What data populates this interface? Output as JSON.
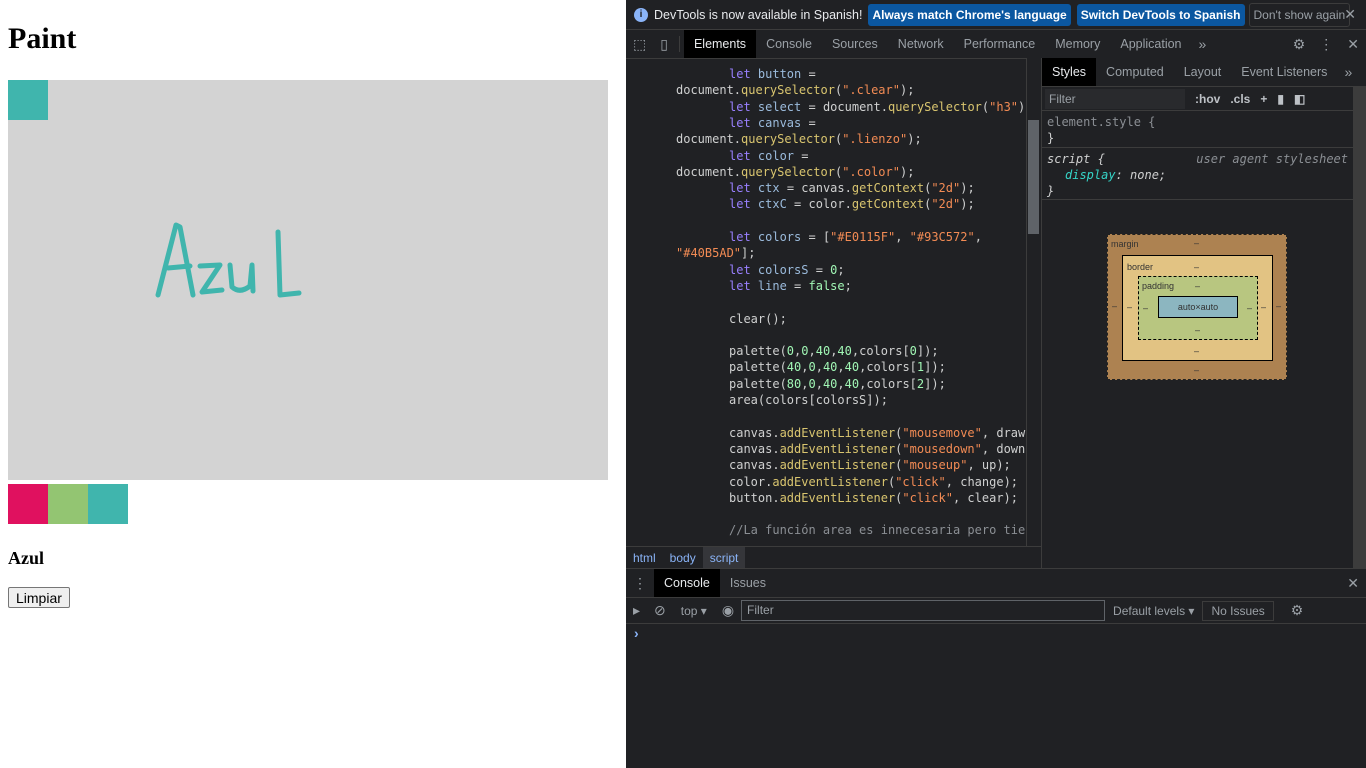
{
  "page": {
    "title": "Paint",
    "selected_color_name": "Azul",
    "clear_label": "Limpiar",
    "drawn_text": "Azul",
    "canvas_bg": "#D3D3D3",
    "selected_color": "#40B5AD",
    "palette": [
      "#E0115F",
      "#93C572",
      "#40B5AD"
    ]
  },
  "devtools": {
    "infobar": {
      "message": "DevTools is now available in Spanish!",
      "btn1": "Always match Chrome's language",
      "btn2": "Switch DevTools to Spanish",
      "btn3": "Don't show again"
    },
    "tabs": [
      "Elements",
      "Console",
      "Sources",
      "Network",
      "Performance",
      "Memory",
      "Application"
    ],
    "code": [
      [
        [
          "let ",
          "kw"
        ],
        [
          "button",
          "vr"
        ],
        [
          " =",
          "pl"
        ]
      ],
      [
        [
          "document.",
          "pl"
        ],
        [
          "querySelector",
          "mt"
        ],
        [
          "(",
          "pl"
        ],
        [
          "\".clear\"",
          "st"
        ],
        [
          ");",
          "pl"
        ]
      ],
      [
        [
          "let ",
          "kw"
        ],
        [
          "select",
          "vr"
        ],
        [
          " = document.",
          "pl"
        ],
        [
          "querySelector",
          "mt"
        ],
        [
          "(",
          "pl"
        ],
        [
          "\"h3\"",
          "st"
        ],
        [
          ");",
          "pl"
        ]
      ],
      [
        [
          "let ",
          "kw"
        ],
        [
          "canvas",
          "vr"
        ],
        [
          " =",
          "pl"
        ]
      ],
      [
        [
          "document.",
          "pl"
        ],
        [
          "querySelector",
          "mt"
        ],
        [
          "(",
          "pl"
        ],
        [
          "\".lienzo\"",
          "st"
        ],
        [
          ");",
          "pl"
        ]
      ],
      [
        [
          "let ",
          "kw"
        ],
        [
          "color",
          "vr"
        ],
        [
          " =",
          "pl"
        ]
      ],
      [
        [
          "document.",
          "pl"
        ],
        [
          "querySelector",
          "mt"
        ],
        [
          "(",
          "pl"
        ],
        [
          "\".color\"",
          "st"
        ],
        [
          ");",
          "pl"
        ]
      ],
      [
        [
          "let ",
          "kw"
        ],
        [
          "ctx",
          "vr"
        ],
        [
          " = canvas.",
          "pl"
        ],
        [
          "getContext",
          "mt"
        ],
        [
          "(",
          "pl"
        ],
        [
          "\"2d\"",
          "st"
        ],
        [
          ");",
          "pl"
        ]
      ],
      [
        [
          "let ",
          "kw"
        ],
        [
          "ctxC",
          "vr"
        ],
        [
          " = color.",
          "pl"
        ],
        [
          "getContext",
          "mt"
        ],
        [
          "(",
          "pl"
        ],
        [
          "\"2d\"",
          "st"
        ],
        [
          ");",
          "pl"
        ]
      ],
      [],
      [
        [
          "let ",
          "kw"
        ],
        [
          "colors",
          "vr"
        ],
        [
          " = [",
          "pl"
        ],
        [
          "\"#E0115F\"",
          "st"
        ],
        [
          ", ",
          "pl"
        ],
        [
          "\"#93C572\"",
          "st"
        ],
        [
          ",",
          "pl"
        ]
      ],
      [
        [
          "\"#40B5AD\"",
          "st"
        ],
        [
          "];",
          "pl"
        ]
      ],
      [
        [
          "let ",
          "kw"
        ],
        [
          "colorsS",
          "vr"
        ],
        [
          " = ",
          "pl"
        ],
        [
          "0",
          "nm"
        ],
        [
          ";",
          "pl"
        ]
      ],
      [
        [
          "let ",
          "kw"
        ],
        [
          "line",
          "vr"
        ],
        [
          " = ",
          "pl"
        ],
        [
          "false",
          "nm"
        ],
        [
          ";",
          "pl"
        ]
      ],
      [],
      [
        [
          "clear();",
          "pl"
        ]
      ],
      [],
      [
        [
          "palette(",
          "pl"
        ],
        [
          "0",
          "nm"
        ],
        [
          ",",
          "pl"
        ],
        [
          "0",
          "nm"
        ],
        [
          ",",
          "pl"
        ],
        [
          "40",
          "nm"
        ],
        [
          ",",
          "pl"
        ],
        [
          "40",
          "nm"
        ],
        [
          ",colors[",
          "pl"
        ],
        [
          "0",
          "nm"
        ],
        [
          "]);",
          "pl"
        ]
      ],
      [
        [
          "palette(",
          "pl"
        ],
        [
          "40",
          "nm"
        ],
        [
          ",",
          "pl"
        ],
        [
          "0",
          "nm"
        ],
        [
          ",",
          "pl"
        ],
        [
          "40",
          "nm"
        ],
        [
          ",",
          "pl"
        ],
        [
          "40",
          "nm"
        ],
        [
          ",colors[",
          "pl"
        ],
        [
          "1",
          "nm"
        ],
        [
          "]);",
          "pl"
        ]
      ],
      [
        [
          "palette(",
          "pl"
        ],
        [
          "80",
          "nm"
        ],
        [
          ",",
          "pl"
        ],
        [
          "0",
          "nm"
        ],
        [
          ",",
          "pl"
        ],
        [
          "40",
          "nm"
        ],
        [
          ",",
          "pl"
        ],
        [
          "40",
          "nm"
        ],
        [
          ",colors[",
          "pl"
        ],
        [
          "2",
          "nm"
        ],
        [
          "]);",
          "pl"
        ]
      ],
      [
        [
          "area(colors[colorsS]);",
          "pl"
        ]
      ],
      [],
      [
        [
          "canvas.",
          "pl"
        ],
        [
          "addEventListener",
          "mt"
        ],
        [
          "(",
          "pl"
        ],
        [
          "\"mousemove\"",
          "st"
        ],
        [
          ", draw);",
          "pl"
        ]
      ],
      [
        [
          "canvas.",
          "pl"
        ],
        [
          "addEventListener",
          "mt"
        ],
        [
          "(",
          "pl"
        ],
        [
          "\"mousedown\"",
          "st"
        ],
        [
          ", down);",
          "pl"
        ]
      ],
      [
        [
          "canvas.",
          "pl"
        ],
        [
          "addEventListener",
          "mt"
        ],
        [
          "(",
          "pl"
        ],
        [
          "\"mouseup\"",
          "st"
        ],
        [
          ", up);",
          "pl"
        ]
      ],
      [
        [
          "color.",
          "pl"
        ],
        [
          "addEventListener",
          "mt"
        ],
        [
          "(",
          "pl"
        ],
        [
          "\"click\"",
          "st"
        ],
        [
          ", change);",
          "pl"
        ]
      ],
      [
        [
          "button.",
          "pl"
        ],
        [
          "addEventListener",
          "mt"
        ],
        [
          "(",
          "pl"
        ],
        [
          "\"click\"",
          "st"
        ],
        [
          ", clear);",
          "pl"
        ]
      ],
      [],
      [
        [
          "//La función area es innecesaria pero tiene",
          "cm"
        ]
      ]
    ],
    "code_indent": [
      1,
      0,
      1,
      1,
      0,
      1,
      0,
      1,
      1,
      1,
      1,
      0,
      1,
      1,
      1,
      1,
      1,
      1,
      1,
      1,
      1,
      1,
      1,
      1,
      1,
      1,
      1,
      1,
      1
    ],
    "breadcrumbs": [
      "html",
      "body",
      "script"
    ],
    "styles_tabs": [
      "Styles",
      "Computed",
      "Layout",
      "Event Listeners"
    ],
    "styles_filter": {
      "placeholder": "Filter",
      "hov": ":hov",
      "cls": ".cls"
    },
    "rules": {
      "element_style": "element.style {",
      "close": "}",
      "selector": "script {",
      "source": "user agent stylesheet",
      "prop": "display",
      "value": "none;"
    },
    "box_model": {
      "margin": "margin",
      "border": "border",
      "padding": "padding",
      "content": "auto×auto",
      "dash": "–"
    },
    "drawer": {
      "tabs": [
        "Console",
        "Issues"
      ],
      "context": "top",
      "filter_placeholder": "Filter",
      "levels": "Default levels",
      "issues": "No Issues",
      "prompt": "›"
    }
  }
}
